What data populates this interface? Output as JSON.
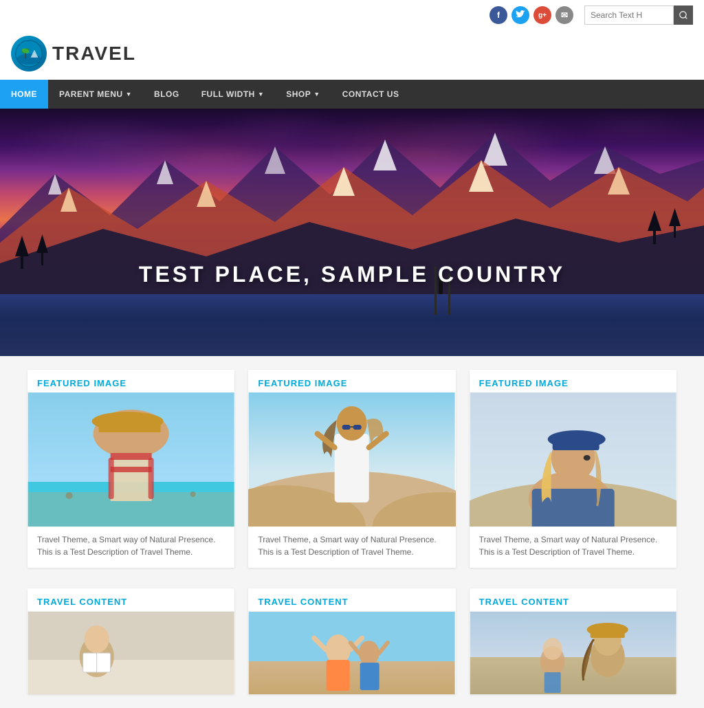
{
  "topbar": {
    "social": [
      {
        "name": "facebook",
        "label": "f",
        "class": "si-fb"
      },
      {
        "name": "twitter",
        "label": "t",
        "class": "si-tw"
      },
      {
        "name": "google",
        "label": "g+",
        "class": "si-gp"
      },
      {
        "name": "email",
        "label": "✉",
        "class": "si-em"
      }
    ],
    "search_placeholder": "Search Text H",
    "search_btn_icon": "🔍"
  },
  "logo": {
    "text": "TRAVEL"
  },
  "nav": {
    "items": [
      {
        "label": "HOME",
        "active": true,
        "has_arrow": false
      },
      {
        "label": "PARENT MENU",
        "active": false,
        "has_arrow": true
      },
      {
        "label": "BLOG",
        "active": false,
        "has_arrow": false
      },
      {
        "label": "FULL WIDTH",
        "active": false,
        "has_arrow": true
      },
      {
        "label": "SHOP",
        "active": false,
        "has_arrow": true
      },
      {
        "label": "CONTACT US",
        "active": false,
        "has_arrow": false
      }
    ]
  },
  "hero": {
    "title": "TEST PLACE, SAMPLE COUNTRY"
  },
  "featured_cards": [
    {
      "label_static": "FEATURED ",
      "label_color": "IMAGE",
      "description": "Travel Theme, a Smart way of Natural Presence. This is a Test Description of Travel Theme.",
      "img_class": "img-beach-girl"
    },
    {
      "label_static": "FEATURED ",
      "label_color": "IMAGE",
      "description": "Travel Theme, a Smart way of Natural Presence. This is a Test Description of Travel Theme.",
      "img_class": "img-sand-girl"
    },
    {
      "label_static": "FEATURED ",
      "label_color": "IMAGE",
      "description": "Travel Theme, a Smart way of Natural Presence. This is a Test Description of Travel Theme.",
      "img_class": "img-hat-girl"
    }
  ],
  "content_cards": [
    {
      "label_static": "TRAVEL ",
      "label_color": "CONTENT",
      "img_class": "img-girl-book"
    },
    {
      "label_static": "TRAVEL ",
      "label_color": "CONTENT",
      "img_class": "img-beach-fun"
    },
    {
      "label_static": "TRAVEL ",
      "label_color": "CONTENT",
      "img_class": "img-hat-beach"
    }
  ]
}
